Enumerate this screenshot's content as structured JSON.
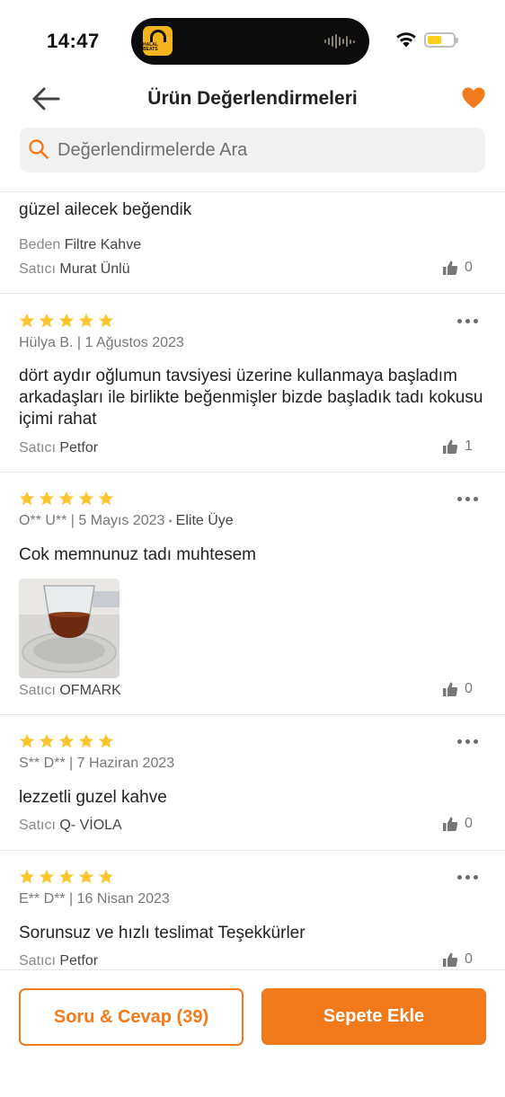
{
  "status_bar": {
    "time": "14:47",
    "island_app_label": "HALAL BEATS",
    "battery_color": "#f7cf1d"
  },
  "header": {
    "title": "Ürün Değerlendirmeleri",
    "back_icon": "arrow-left-icon",
    "favorite_icon": "heart-icon",
    "accent": "#f27a1a"
  },
  "search": {
    "placeholder": "Değerlendirmelerde Ara",
    "value": ""
  },
  "labels": {
    "size_label": "Beden",
    "seller_label": "Satıcı"
  },
  "reviews": [
    {
      "text": "güzel ailecek beğendik",
      "size": "Filtre Kahve",
      "seller": "Murat Ünlü",
      "likes": "0"
    },
    {
      "rating": 5,
      "meta": "Hülya B. | 1 Ağustos 2023",
      "text": "dört aydır oğlumun tavsiyesi üzerine kullanmaya başladım arkadaşları ile birlikte beğenmişler bizde başladık tadı kokusu içimi rahat",
      "seller": "Petfor",
      "likes": "1"
    },
    {
      "rating": 5,
      "meta": "O** U** | 5 Mayıs 2023",
      "badge": "Elite Üye",
      "text": "Cok memnunuz tadı muhtesem",
      "seller": "OFMARK",
      "likes": "0"
    },
    {
      "rating": 5,
      "meta": "S** D** | 7 Haziran 2023",
      "text": "lezzetli guzel kahve",
      "seller": "Q- VİOLA",
      "likes": "0"
    },
    {
      "rating": 5,
      "meta": "E** D** | 16 Nisan 2023",
      "text": "Sorunsuz ve hızlı teslimat Teşekkürler",
      "seller": "Petfor",
      "likes": "0"
    }
  ],
  "actions": {
    "qa_label": "Soru & Cevap (39)",
    "cart_label": "Sepete Ekle"
  }
}
